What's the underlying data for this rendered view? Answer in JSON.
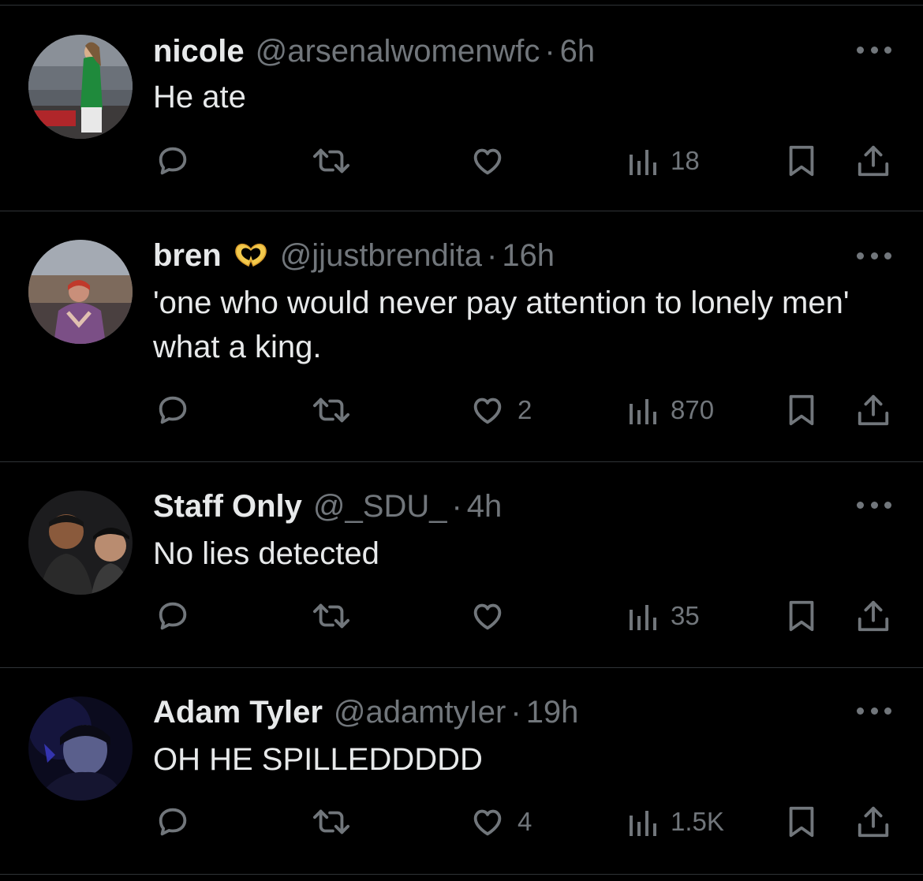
{
  "tweets": [
    {
      "name": "nicole",
      "handle": "@arsenalwomenwfc",
      "dot": "·",
      "time": "6h",
      "text": "He ate",
      "likes": "",
      "views": "18"
    },
    {
      "name": "bren",
      "emoji": "🫶",
      "handle": "@jjustbrendita",
      "dot": "·",
      "time": "16h",
      "text": "'one who would never pay attention to lonely men' what a king.",
      "likes": "2",
      "views": "870"
    },
    {
      "name": "Staff Only",
      "handle": "@_SDU_",
      "dot": "·",
      "time": "4h",
      "text": "No lies detected",
      "likes": "",
      "views": "35"
    },
    {
      "name": "Adam Tyler",
      "handle": "@adamtyIer",
      "dot": "·",
      "time": "19h",
      "text": "OH HE SPILLEDDDDD",
      "likes": "4",
      "views": "1.5K"
    }
  ],
  "icons": {
    "reply": "reply-icon",
    "retweet": "retweet-icon",
    "like": "heart-icon",
    "views": "views-icon",
    "bookmark": "bookmark-icon",
    "share": "share-icon",
    "more": "more-icon"
  },
  "colors": {
    "background": "#000000",
    "primary_text": "#e7e9ea",
    "secondary_text": "#71767b",
    "divider": "#2f3336"
  }
}
